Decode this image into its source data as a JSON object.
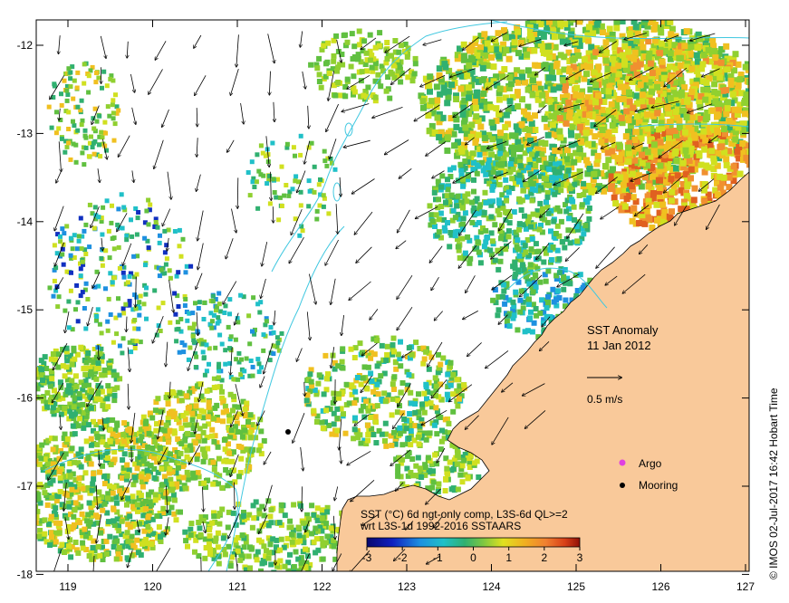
{
  "map": {
    "title_line1": "SST Anomaly",
    "title_line2": "11 Jan 2012",
    "scale_label": "0.5 m/s",
    "credit": "© IMOS 02-Jul-2017 16:42 Hobart Time",
    "x_ticks": [
      "119",
      "120",
      "121",
      "122",
      "123",
      "124",
      "125",
      "126",
      "127"
    ],
    "y_ticks": [
      "-12",
      "-13",
      "-14",
      "-15",
      "-16",
      "-17",
      "-18"
    ],
    "legend": {
      "argo_label": "Argo",
      "mooring_label": "Mooring"
    },
    "colorbar": {
      "line1": "SST (°C) 6d ngt-only comp, L3S-6d QL>=2",
      "line2": "wrt L3S-1d 1992-2016 SSTAARS",
      "ticks": [
        "-3",
        "-2",
        "-1",
        "0",
        "1",
        "2",
        "3"
      ]
    },
    "colors": {
      "land": "#f9c99a",
      "bathymetry": "#40c8e0",
      "argo": "#e040e0",
      "arrow": "#000000"
    }
  }
}
